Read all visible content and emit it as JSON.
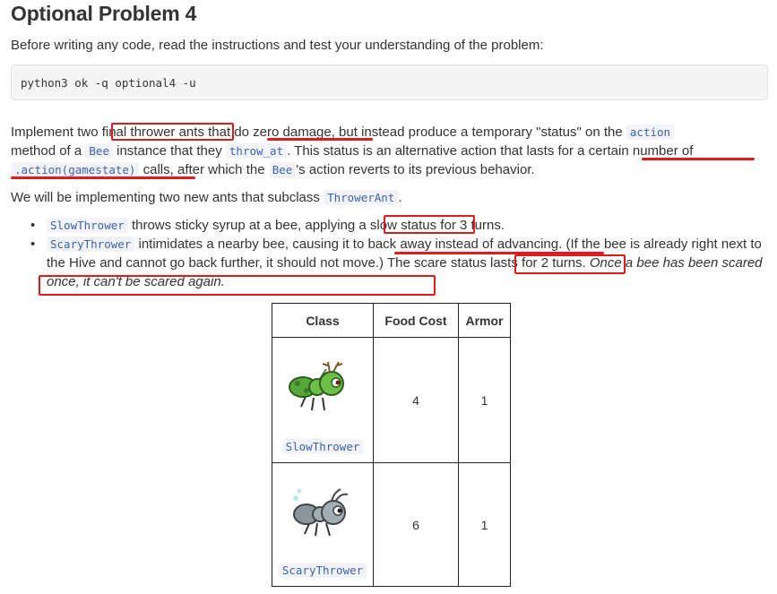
{
  "title": "Optional Problem 4",
  "intro": "Before writing any code, read the instructions and test your understanding of the problem:",
  "command": "python3 ok -q optional4 -u",
  "paragraph1": {
    "t1": "Implement two ",
    "final_thrower_ants": "final thrower ants",
    "t2": " that ",
    "do_zero_damage": "do zero damage",
    "t3": ", but instead produce a temporary \"status\" on the ",
    "code_action": "action",
    "t4": " method of a ",
    "code_bee": "Bee",
    "t5": " instance that they ",
    "code_throw_at": "throw_at",
    "t6": ". This status is an alternative action that lasts for ",
    "certain_number": "a certain number of",
    "t7": " ",
    "code_action_call": ".action(gamestate)",
    "t8": " calls",
    "t9": ", after which the ",
    "code_bee2": "Bee",
    "t10": "'s action reverts to its previous behavior."
  },
  "paragraph2": {
    "t1": "We will be implementing two new ants that subclass ",
    "code_throwerant": "ThrowerAnt",
    "t2": "."
  },
  "bullets": {
    "b1": {
      "code": "SlowThrower",
      "t1": " throws sticky syrup at a bee, applying ",
      "slow_status": "a slow status",
      "t2": " for 3 turns."
    },
    "b2": {
      "code": "ScaryThrower",
      "t1": " intimidates a nearby bee, causing it to ",
      "back_away": "back away instead of advancing",
      "t2": ". (If the bee is already right next to the Hive and cannot go back further, it should not move.) ",
      "scare_status": "The scare status",
      "t3": " lasts for 2 turns. ",
      "once": "Once a bee has been scared once, it can't be scared again."
    }
  },
  "table": {
    "headers": [
      "Class",
      "Food Cost",
      "Armor"
    ],
    "rows": [
      {
        "class": "SlowThrower",
        "icon": "green-ant-icon",
        "food_cost": "4",
        "armor": "1"
      },
      {
        "class": "ScaryThrower",
        "icon": "gray-ant-icon",
        "food_cost": "6",
        "armor": "1"
      }
    ]
  },
  "colors": {
    "annotation_red": "#e01b1b",
    "code_text": "#3d62b0",
    "code_bg": "#f1f3f7",
    "slow_ant_green": "#57a83a",
    "scary_ant_gray": "#8a969c"
  }
}
